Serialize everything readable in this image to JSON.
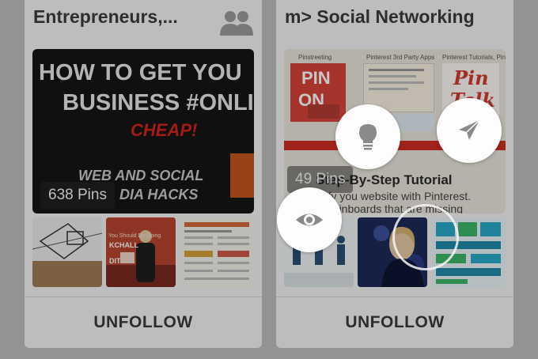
{
  "boards": [
    {
      "title": "Entrepreneurs,...",
      "icon": "group-icon",
      "pin_count": "638 Pins",
      "cover_lines": [
        "HOW TO GET YOU",
        "BUSINESS #ONLIN",
        "CHEAP!",
        "WEB AND SOCIAL",
        "DIA HACKS"
      ],
      "thumb_text": [
        "You Should Be Doing",
        "KCHALL",
        "DIT"
      ],
      "action": "UNFOLLOW"
    },
    {
      "title": "m> Social Networking",
      "pin_count": "49 Pins",
      "cover_headers": [
        "Pinstreeting",
        "Pinterest 3rd Party Apps",
        "Pinterest Tutorials, Pint"
      ],
      "cover_tiles": [
        "PIN",
        "ON",
        "Pin",
        "Talk"
      ],
      "cover_step": "Step-By-Step Tutorial",
      "cover_sub": [
        "erify you website with Pinterest.",
        "ew pinboards that are missing"
      ],
      "action": "UNFOLLOW"
    }
  ],
  "actions": [
    {
      "icon": "eye-icon"
    },
    {
      "icon": "lightbulb-icon"
    },
    {
      "icon": "send-icon"
    }
  ],
  "colors": {
    "background": "#bdbdbd",
    "card": "#f2f2f2",
    "accent_red": "#d4241c",
    "fab": "#fdfdfd",
    "icon_gray": "#8a8a8a"
  }
}
